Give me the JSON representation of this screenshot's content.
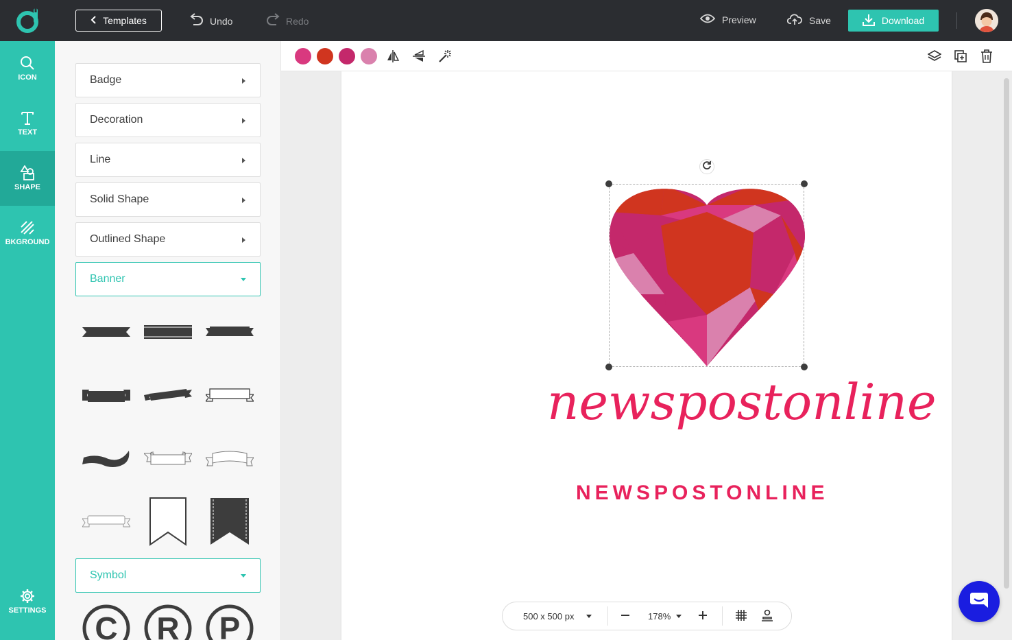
{
  "topbar": {
    "templates_label": "Templates",
    "undo_label": "Undo",
    "redo_label": "Redo",
    "preview_label": "Preview",
    "save_label": "Save",
    "download_label": "Download"
  },
  "rail": {
    "items": [
      {
        "label": "ICON",
        "icon": "search-icon"
      },
      {
        "label": "TEXT",
        "icon": "text-icon"
      },
      {
        "label": "SHAPE",
        "icon": "shape-icon",
        "active": true
      },
      {
        "label": "BKGROUND",
        "icon": "background-icon"
      }
    ],
    "settings_label": "SETTINGS"
  },
  "panel": {
    "categories": [
      {
        "label": "Badge",
        "open": false
      },
      {
        "label": "Decoration",
        "open": false
      },
      {
        "label": "Line",
        "open": false
      },
      {
        "label": "Solid Shape",
        "open": false
      },
      {
        "label": "Outlined Shape",
        "open": false
      },
      {
        "label": "Banner",
        "open": true
      },
      {
        "label": "Symbol",
        "open": true
      }
    ],
    "symbols": [
      "C",
      "R",
      "P"
    ]
  },
  "toolbar": {
    "swatches": [
      "#d9397f",
      "#d0351f",
      "#c4286b",
      "#da81ad"
    ]
  },
  "canvas": {
    "script_text": "newspostonline",
    "caps_text": "NEWSPOSTONLINE",
    "text_color": "#e8225c"
  },
  "zoombar": {
    "size_label": "500 x 500 px",
    "zoom_label": "178%"
  },
  "colors": {
    "accent": "#2ec4b0",
    "topbar": "#2b2d31",
    "chat": "#1a1de0"
  }
}
